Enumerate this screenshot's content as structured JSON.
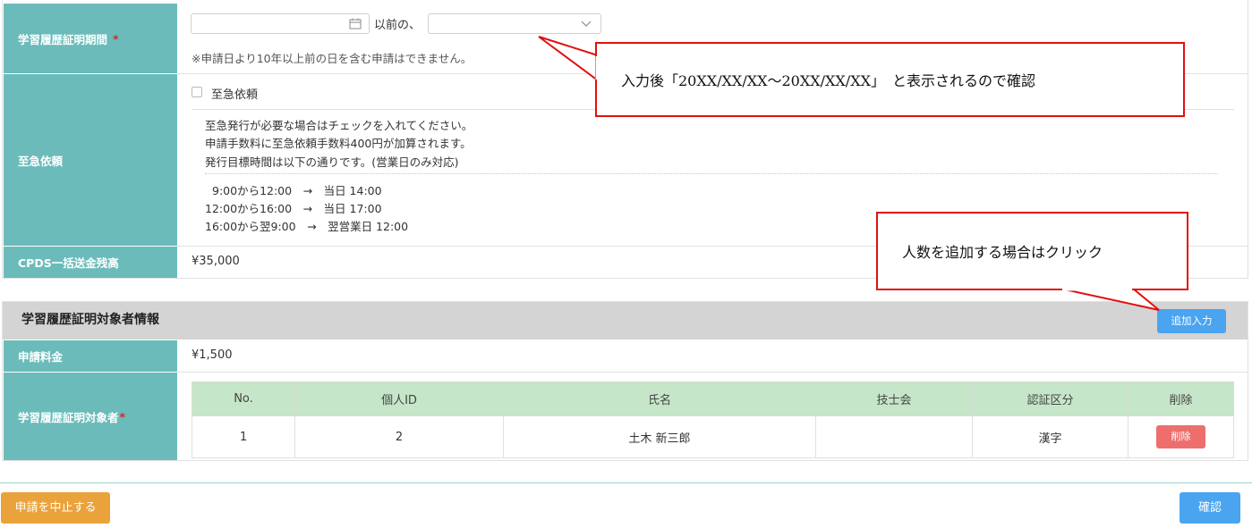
{
  "form": {
    "period": {
      "label": "学習履歴証明期間",
      "required_mark": "*",
      "between_text": "以前の、",
      "note": "※申請日より10年以上前の日を含む申請はできません。"
    },
    "urgent": {
      "label": "至急依頼",
      "checkbox_label": "至急依頼",
      "lines": [
        "至急発行が必要な場合はチェックを入れてください。",
        "申請手数料に至急依頼手数料400円が加算されます。",
        "発行目標時間は以下の通りです。(営業日のみ対応)"
      ],
      "schedule": [
        "9:00から12:00　→　当日 14:00",
        "12:00から16:00　→　当日 17:00",
        "16:00から翌9:00　→　翌営業日 12:00"
      ]
    },
    "cpds": {
      "label": "CPDS一括送金残高",
      "value": "¥35,000"
    }
  },
  "section": {
    "title": "学習履歴証明対象者情報",
    "add_button": "追加入力",
    "fee_label": "申請料金",
    "fee_value": "¥1,500",
    "target_label": "学習履歴証明対象者",
    "target_required": "*"
  },
  "table": {
    "headers": [
      "No.",
      "個人ID",
      "氏名",
      "技士会",
      "認証区分",
      "削除"
    ],
    "row": {
      "no": "1",
      "id": "2",
      "name": "土木 新三郎",
      "association": "",
      "auth": "漢字",
      "delete": "削除"
    }
  },
  "footer": {
    "cancel": "申請を中止する",
    "confirm": "確認"
  },
  "callouts": {
    "top": "入力後「20XX/XX/XX～20XX/XX/XX」　と表示されるので確認",
    "bottom": "人数を追加する場合はクリック"
  },
  "colors": {
    "label_bg": "#6cbbbb",
    "section_header_bg": "#d4d4d4",
    "table_header_bg": "#c5e6c8",
    "button_blue": "#4aa4f0",
    "button_orange": "#eaa23a",
    "button_red": "#ee6e6e",
    "callout_border": "#e01010"
  }
}
